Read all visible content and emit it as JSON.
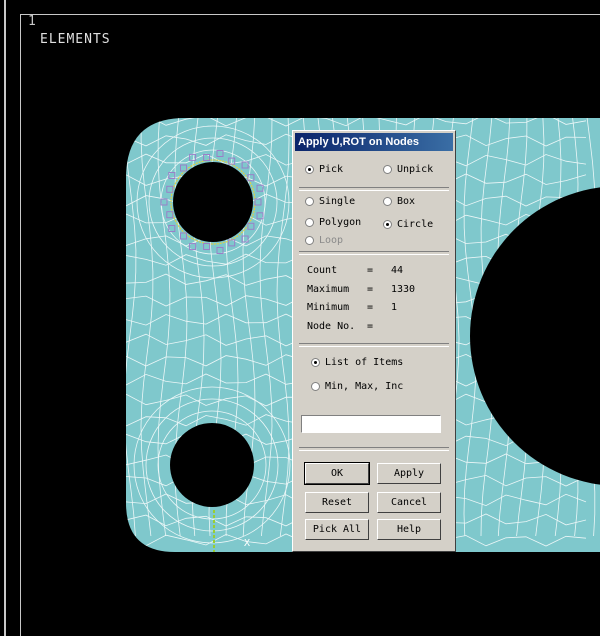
{
  "viewport": {
    "window_number": "1",
    "plot_title": "ELEMENTS",
    "triad_label": "X"
  },
  "dialog": {
    "title": "Apply U,ROT on Nodes",
    "pick_mode": {
      "pick": "Pick",
      "unpick": "Unpick",
      "selected": "pick"
    },
    "shape": {
      "single": "Single",
      "box": "Box",
      "polygon": "Polygon",
      "circle": "Circle",
      "loop": "Loop",
      "selected": "circle"
    },
    "info": {
      "count_label": "Count",
      "count_value": "44",
      "maximum_label": "Maximum",
      "maximum_value": "1330",
      "minimum_label": "Minimum",
      "minimum_value": "1",
      "node_label": "Node No.",
      "equals": "="
    },
    "entry_mode": {
      "list": "List of Items",
      "minmax": "Min, Max, Inc",
      "selected": "list"
    },
    "input_value": "",
    "buttons": {
      "ok": "OK",
      "apply": "Apply",
      "reset": "Reset",
      "cancel": "Cancel",
      "pick_all": "Pick All",
      "help": "Help"
    }
  },
  "colors": {
    "background": "#000000",
    "mesh_fill": "#7fc8cc",
    "mesh_lines": "#ffffff",
    "node_marker": "#9a7fc8",
    "selection_outline": "#e0d040",
    "triad": "#9acd32",
    "dialog_face": "#d4d0c8",
    "title_bar": "#0a246a"
  }
}
